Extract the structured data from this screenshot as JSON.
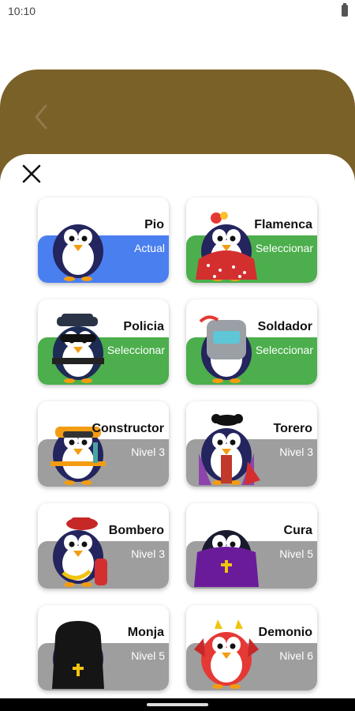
{
  "status_bar": {
    "time": "10:10"
  },
  "header": {
    "back_icon": "chevron-left-icon",
    "background": "#7a6128"
  },
  "sheet": {
    "close_icon": "close-icon"
  },
  "colors": {
    "current": "#4a7ff0",
    "select": "#4cae4c",
    "locked": "#9e9e9e"
  },
  "characters": [
    {
      "name": "Pio",
      "action": "Actual",
      "state": "current",
      "accessory": "none"
    },
    {
      "name": "Flamenca",
      "action": "Seleccionar",
      "state": "select",
      "accessory": "flamenca"
    },
    {
      "name": "Policia",
      "action": "Seleccionar",
      "state": "select",
      "accessory": "police"
    },
    {
      "name": "Soldador",
      "action": "Seleccionar",
      "state": "select",
      "accessory": "welder"
    },
    {
      "name": "Constructor",
      "action": "Nivel 3",
      "state": "locked",
      "accessory": "builder"
    },
    {
      "name": "Torero",
      "action": "Nivel 3",
      "state": "locked",
      "accessory": "torero"
    },
    {
      "name": "Bombero",
      "action": "Nivel 3",
      "state": "locked",
      "accessory": "firefighter"
    },
    {
      "name": "Cura",
      "action": "Nivel 5",
      "state": "locked",
      "accessory": "priest"
    },
    {
      "name": "Monja",
      "action": "Nivel 5",
      "state": "locked",
      "accessory": "nun"
    },
    {
      "name": "Demonio",
      "action": "Nivel 6",
      "state": "locked",
      "accessory": "devil"
    }
  ]
}
